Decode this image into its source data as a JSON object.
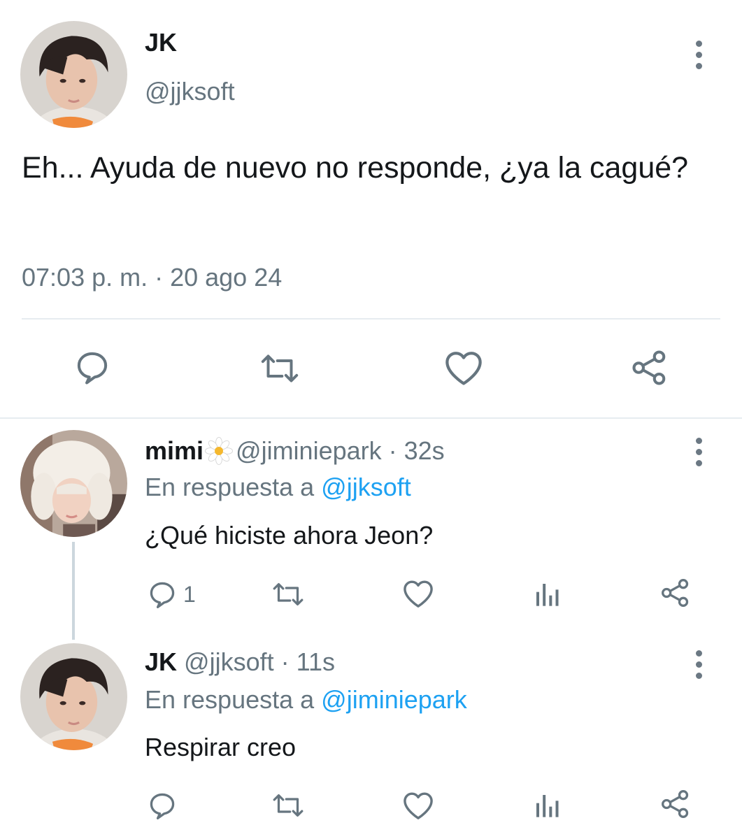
{
  "main_tweet": {
    "name": "JK",
    "handle": "@jjksoft",
    "text": "Eh... Ayuda de nuevo no responde, ¿ya la cagué?",
    "timestamp": "07:03 p. m. · 20 ago 24"
  },
  "replies": [
    {
      "name": "mimi",
      "name_emoji": "flower-icon",
      "handle": "@jiminiepark",
      "time": "· 32s",
      "reply_prefix": "En respuesta a",
      "reply_to": "@jjksoft",
      "text": "¿Qué hiciste ahora Jeon?",
      "reply_count": "1"
    },
    {
      "name": "JK",
      "handle": "@jjksoft",
      "time": "· 11s",
      "reply_prefix": "En respuesta a",
      "reply_to": "@jiminiepark",
      "text": "Respirar creo",
      "reply_count": ""
    }
  ],
  "icons": [
    "reply-icon",
    "retweet-icon",
    "like-icon",
    "share-icon",
    "analytics-icon",
    "more-options-icon"
  ],
  "colors": {
    "text": "#14171a",
    "secondary": "#66757f",
    "link": "#1da1f2",
    "divider": "#e6ecf0"
  }
}
